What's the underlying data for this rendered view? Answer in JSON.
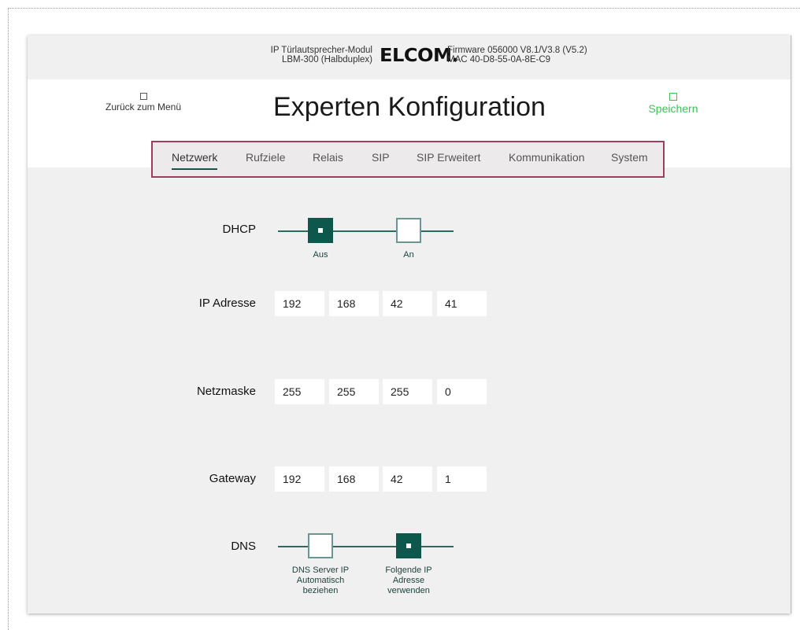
{
  "header": {
    "device_line1": "IP Türlautsprecher-Modul",
    "device_line2": "LBM-300 (Halbduplex)",
    "logo": "ELCOM.",
    "firmware_line1": "Firmware 056000 V8.1/V3.8 (V5.2)",
    "firmware_line2": "MAC 40-D8-55-0A-8E-C9"
  },
  "nav": {
    "back_label": "Zurück zum Menü",
    "back_icon": "square-icon",
    "title": "Experten Konfiguration",
    "save_label": "Speichern",
    "save_icon": "square-icon"
  },
  "tabs": [
    {
      "label": "Netzwerk",
      "active": true
    },
    {
      "label": "Rufziele",
      "active": false
    },
    {
      "label": "Relais",
      "active": false
    },
    {
      "label": "SIP",
      "active": false
    },
    {
      "label": "SIP Erweitert",
      "active": false
    },
    {
      "label": "Kommunikation",
      "active": false
    },
    {
      "label": "System",
      "active": false
    }
  ],
  "form": {
    "dhcp": {
      "label": "DHCP",
      "options": [
        "Aus",
        "An"
      ],
      "selected": "Aus"
    },
    "ip_address": {
      "label": "IP Adresse",
      "octets": [
        "192",
        "168",
        "42",
        "41"
      ]
    },
    "netmask": {
      "label": "Netzmaske",
      "octets": [
        "255",
        "255",
        "255",
        "0"
      ]
    },
    "gateway": {
      "label": "Gateway",
      "octets": [
        "192",
        "168",
        "42",
        "1"
      ]
    },
    "dns": {
      "label": "DNS",
      "options": [
        [
          "DNS Server IP",
          "Automatisch",
          "beziehen"
        ],
        [
          "Folgende IP",
          "Adresse",
          "verwenden"
        ]
      ],
      "selected_index": 1
    }
  },
  "colors": {
    "accent": "#0d574c",
    "tab_border": "#a03c5e",
    "save": "#3fbf5a"
  }
}
